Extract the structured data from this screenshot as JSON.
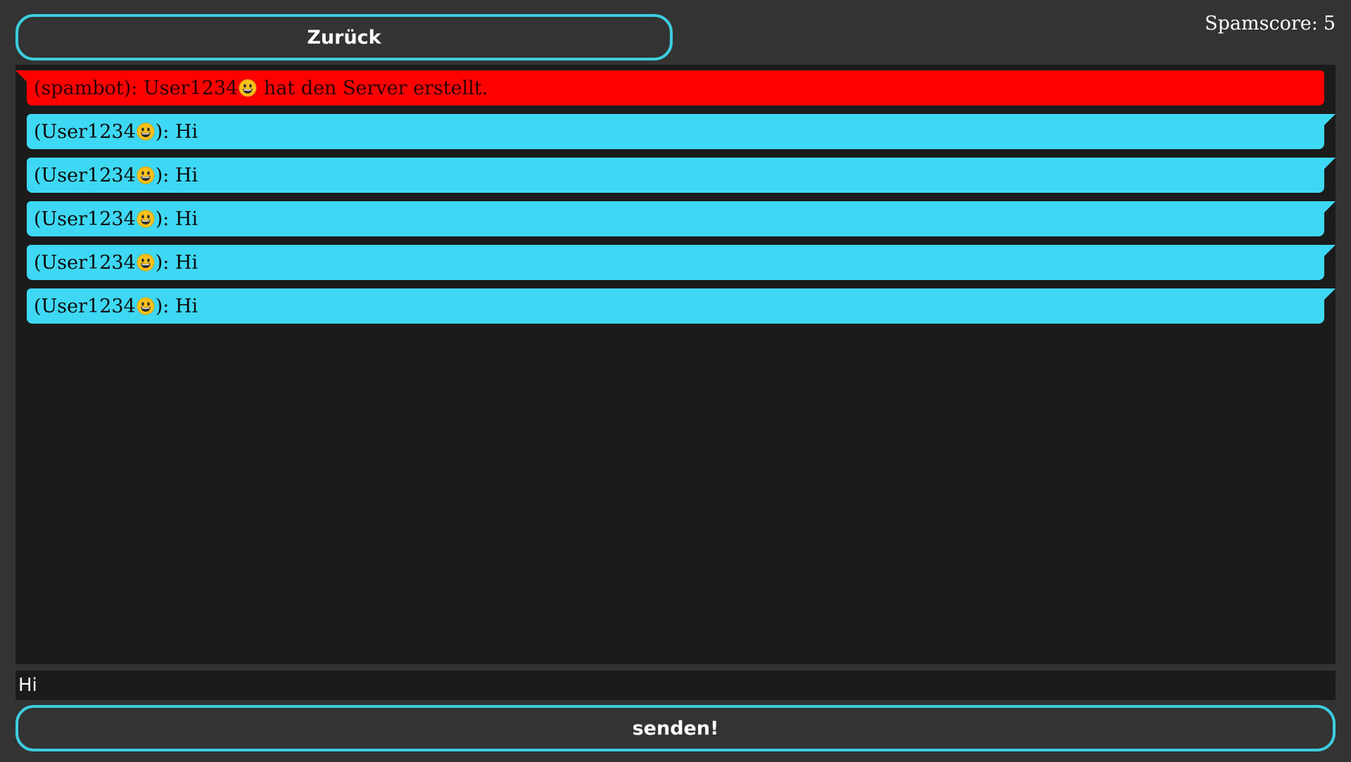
{
  "header": {
    "back_label": "Zurück",
    "spamscore_label": "Spamscore:",
    "spamscore_value": "5"
  },
  "messages": [
    {
      "type": "system",
      "sender": "(spambot)",
      "sep": ":",
      "mention": "User1234",
      "mention_icon": "grinning-face-icon",
      "text": "hat den Server erstellt.",
      "color": "#ff0000"
    },
    {
      "type": "user",
      "sender": "(User1234",
      "sender_icon": "grinning-face-icon",
      "sep": "):",
      "text": "Hi",
      "color": "#3ed8f4"
    },
    {
      "type": "user",
      "sender": "(User1234",
      "sender_icon": "grinning-face-icon",
      "sep": "):",
      "text": "Hi",
      "color": "#3ed8f4"
    },
    {
      "type": "user",
      "sender": "(User1234",
      "sender_icon": "grinning-face-icon",
      "sep": "):",
      "text": "Hi",
      "color": "#3ed8f4"
    },
    {
      "type": "user",
      "sender": "(User1234",
      "sender_icon": "grinning-face-icon",
      "sep": "):",
      "text": "Hi",
      "color": "#3ed8f4"
    },
    {
      "type": "user",
      "sender": "(User1234",
      "sender_icon": "grinning-face-icon",
      "sep": "):",
      "text": "Hi",
      "color": "#3ed8f4"
    }
  ],
  "composer": {
    "input_value": "Hi",
    "send_label": "senden!"
  },
  "colors": {
    "accent": "#3dcde0",
    "background": "#333333",
    "chat_background": "#1b1b1b"
  }
}
